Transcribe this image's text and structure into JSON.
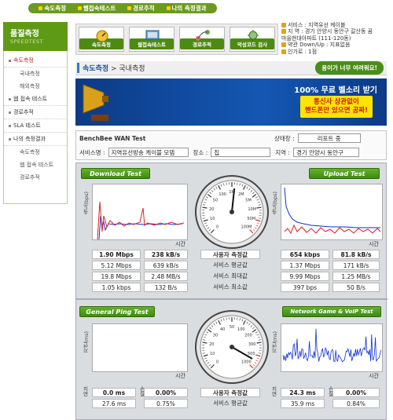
{
  "topnav": [
    {
      "label": "속도측정"
    },
    {
      "label": "웹접속테스트"
    },
    {
      "label": "경로추적"
    },
    {
      "label": "나의 측정결과"
    }
  ],
  "sidebar": {
    "title": "품질측정",
    "subtitle": "SPEEDTEST",
    "items": [
      {
        "label": "속도측정",
        "sub": false,
        "active": true
      },
      {
        "label": "국내측정",
        "sub": true
      },
      {
        "label": "해외측정",
        "sub": true
      },
      {
        "label": "웹 접속 테스트",
        "sub": false
      },
      {
        "label": "경로추적",
        "sub": false
      },
      {
        "label": "SLA 테스트",
        "sub": false
      },
      {
        "label": "나의 측정결과",
        "sub": false
      },
      {
        "label": "속도측정",
        "sub": true
      },
      {
        "label": "웹 접속 테스트",
        "sub": true
      },
      {
        "label": "경로추적",
        "sub": true
      }
    ]
  },
  "features": [
    {
      "label": "속도측정",
      "icon": "speed-icon"
    },
    {
      "label": "웹접속테스트",
      "icon": "web-icon"
    },
    {
      "label": "경로추적",
      "icon": "route-icon"
    },
    {
      "label": "악성코드 검사",
      "icon": "virus-icon"
    }
  ],
  "info": {
    "service": "서비스 : 지역유선 케이블",
    "region": "지 역 : 경기 안양시 동안구 갈산동 꿈",
    "region2": "마을현대아파트 (111-120동)",
    "plan": "약관 Down/Up : 지표없음",
    "load": "인가로 : 1점"
  },
  "titlebar": {
    "section": "속도측정",
    "sep": " > ",
    "page": "국내측정",
    "slow_button": "용이가 너무 여려워요!"
  },
  "banner": {
    "line1_big": "100%",
    "line1": " 무료 벨소리 받기",
    "line2": "통신사 상관없이",
    "line3": "핸드폰만 있으면 공짜!"
  },
  "test": {
    "name": "BenchBee WAN Test",
    "status_label": "상태창 :",
    "status_value": "리포트 중",
    "service_label": "서비스명 :",
    "service_value": "지역유선방송 케이블 모뎀",
    "place_label": "장소 :",
    "place_value": "집",
    "region_label": "지역 :",
    "region_value": "경기 안양시 동안구"
  },
  "dashboard": {
    "download_label": "Download Test",
    "upload_label": "Upload Test",
    "ping_label": "General Ping Test",
    "game_label": "Network Game & VoIP Test",
    "speed_axis": "속도(bps)",
    "delay_axis": "지연(ms)",
    "loss_axis": "손실(%)",
    "time": "시간",
    "mid_header": "사용자 측정값",
    "mid_avg": "서비스 평균값",
    "mid_max": "서비스 최대값",
    "mid_min": "서비스 최소값",
    "download": [
      [
        "1.90 Mbps",
        "238 kB/s"
      ],
      [
        "5.12 Mbps",
        "639 kB/s"
      ],
      [
        "19.8 Mbps",
        "2.48 MB/s"
      ],
      [
        "1.05 kbps",
        "132 B/s"
      ]
    ],
    "upload": [
      [
        "654 kbps",
        "81.8 kB/s"
      ],
      [
        "1.37 Mbps",
        "171 kB/s"
      ],
      [
        "9.99 Mbps",
        "1.25 MB/s"
      ],
      [
        "397 bps",
        "50 B/s"
      ]
    ],
    "ping": [
      [
        "0.0 ms",
        "0.00%"
      ],
      [
        "27.6 ms",
        "0.75%"
      ]
    ],
    "game": [
      [
        "24.3 ms",
        "0.00%"
      ],
      [
        "35.9 ms",
        "0.84%"
      ]
    ],
    "side_delay": "지연",
    "side_loss": "손실",
    "gauge1_labels": [
      "0",
      "10",
      "20",
      "50",
      "100",
      "1M",
      "2M",
      "5M",
      "10M",
      "50M",
      "100M"
    ],
    "gauge2_labels": [
      "0",
      "10",
      "20",
      "30",
      "40",
      "50",
      "100",
      "200",
      "300",
      "500",
      "1000"
    ]
  }
}
